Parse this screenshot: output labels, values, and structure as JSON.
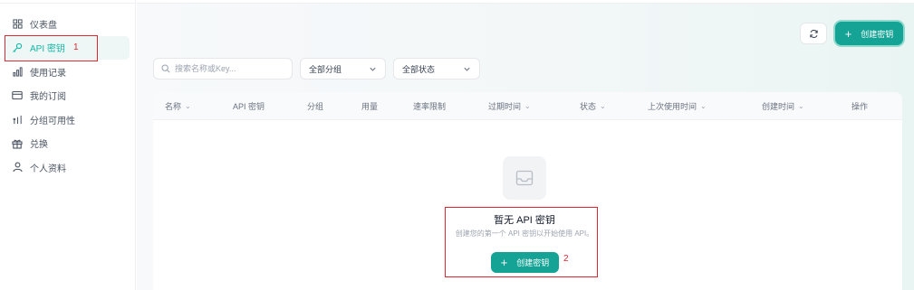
{
  "sidebar": {
    "items": [
      {
        "icon": "dashboard-icon",
        "label": "仪表盘"
      },
      {
        "icon": "key-icon",
        "label": "API 密钥",
        "active": true
      },
      {
        "icon": "bar-chart-icon",
        "label": "使用记录"
      },
      {
        "icon": "card-icon",
        "label": "我的订阅"
      },
      {
        "icon": "group-icon",
        "label": "分组可用性"
      },
      {
        "icon": "gift-icon",
        "label": "兑换"
      },
      {
        "icon": "user-icon",
        "label": "个人资料"
      }
    ]
  },
  "annotations": {
    "sidebar_marker": "1",
    "center_marker": "2",
    "color": "#e0262f"
  },
  "toolbar": {
    "refresh_icon": "refresh-icon",
    "create_label": "创建密钥",
    "search_placeholder": "搜索名称或Key...",
    "group_filter": "全部分组",
    "status_filter": "全部状态"
  },
  "table": {
    "columns": [
      {
        "label": "名称",
        "sortable": true
      },
      {
        "label": "API 密钥",
        "sortable": false
      },
      {
        "label": "分组",
        "sortable": false
      },
      {
        "label": "用量",
        "sortable": false
      },
      {
        "label": "速率限制",
        "sortable": false
      },
      {
        "label": "过期时间",
        "sortable": true
      },
      {
        "label": "状态",
        "sortable": true
      },
      {
        "label": "上次使用时间",
        "sortable": true
      },
      {
        "label": "创建时间",
        "sortable": true
      },
      {
        "label": "操作",
        "sortable": false
      }
    ]
  },
  "empty_state": {
    "icon": "inbox-icon",
    "title": "暂无 API 密钥",
    "description": "创建您的第一个 API 密钥以开始使用 API。",
    "button_label": "创建密钥"
  },
  "colors": {
    "accent": "#14a394",
    "active_text": "#14b8a6",
    "active_bg": "#eef7f6"
  }
}
